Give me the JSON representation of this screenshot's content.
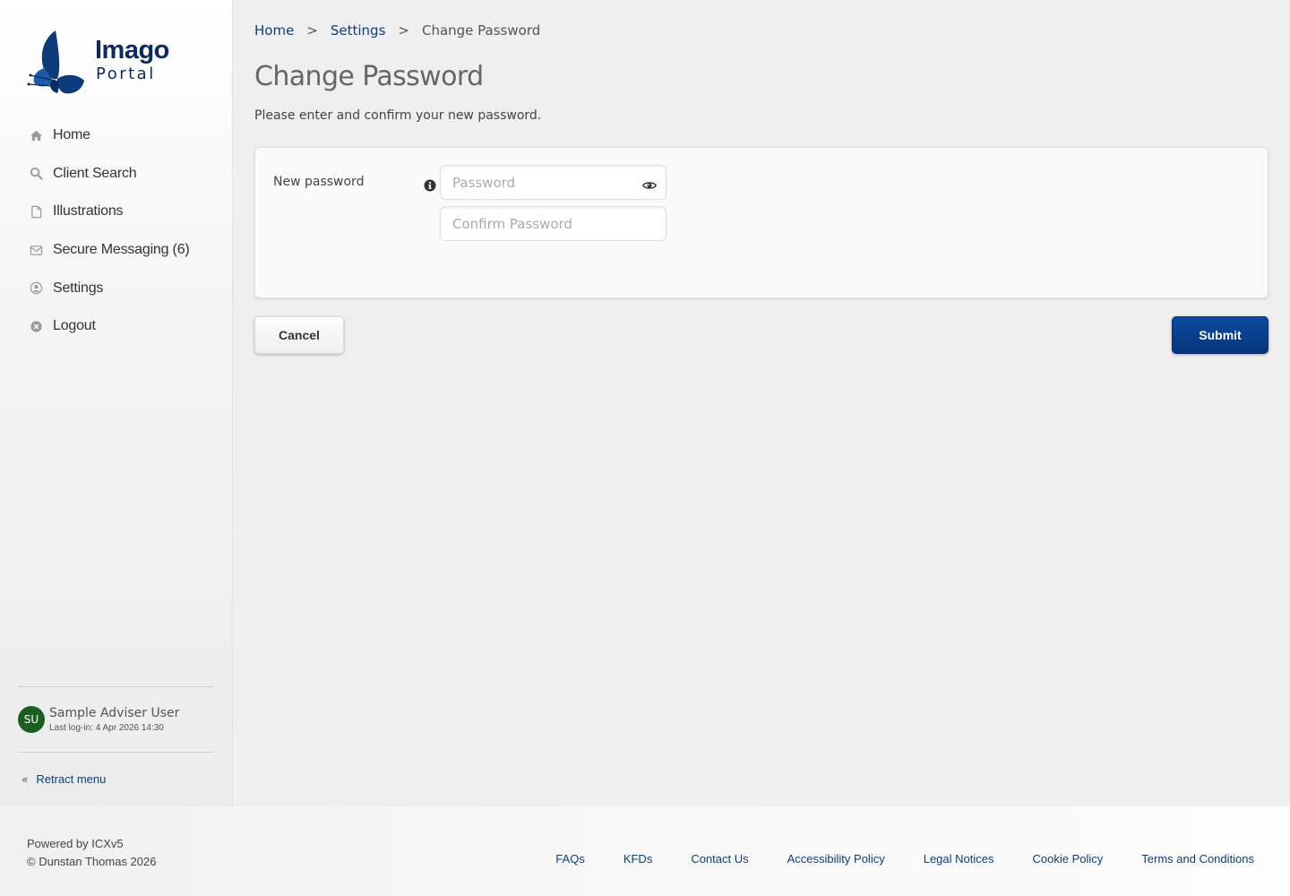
{
  "logo": {
    "line1": "Imago",
    "line2": "Portal",
    "color": "#0c2a5c"
  },
  "sidebar": {
    "items": [
      {
        "label": "Home",
        "icon": "home-icon"
      },
      {
        "label": "Client Search",
        "icon": "search-icon"
      },
      {
        "label": "Illustrations",
        "icon": "document-icon"
      },
      {
        "label": "Secure Messaging (6)",
        "icon": "envelope-icon"
      },
      {
        "label": "Settings",
        "icon": "user-circle-icon"
      },
      {
        "label": "Logout",
        "icon": "close-circle-icon"
      }
    ],
    "user": {
      "initials": "SU",
      "name": "Sample Adviser User",
      "last_login": "Last log-in: 4 Apr 2026 14:30",
      "avatar_color": "#1b5e20"
    },
    "retract_label": "Retract menu"
  },
  "breadcrumb": {
    "items": [
      "Home",
      "Settings"
    ],
    "separator": ">",
    "current": "Change Password"
  },
  "page": {
    "title": "Change Password",
    "subtitle": "Please enter and confirm your new password."
  },
  "form": {
    "new_password_label": "New password",
    "password_placeholder": "Password",
    "password_value": "",
    "confirm_placeholder": "Confirm Password",
    "confirm_value": ""
  },
  "actions": {
    "cancel_label": "Cancel",
    "submit_label": "Submit",
    "submit_color": "#06357a"
  },
  "footer": {
    "powered_by": "Powered by ICXv5",
    "copyright": "© Dunstan Thomas 2026",
    "links": [
      "FAQs",
      "KFDs",
      "Contact Us",
      "Accessibility Policy",
      "Legal Notices",
      "Cookie Policy",
      "Terms and Conditions"
    ]
  }
}
